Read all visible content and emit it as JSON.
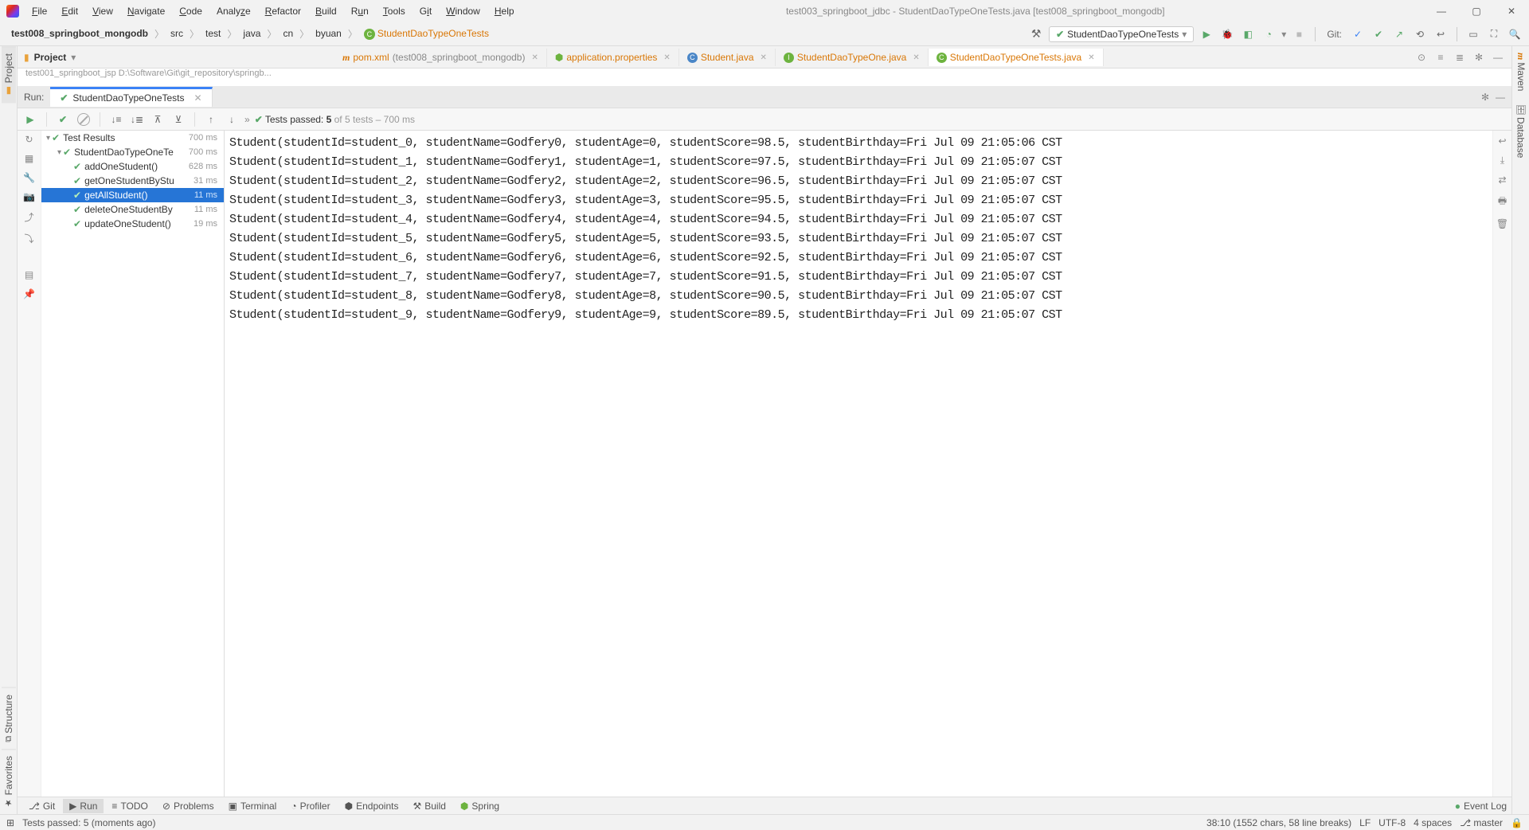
{
  "window": {
    "title": "test003_springboot_jdbc - StudentDaoTypeOneTests.java [test008_springboot_mongodb]"
  },
  "menu": [
    "File",
    "Edit",
    "View",
    "Navigate",
    "Code",
    "Analyze",
    "Refactor",
    "Build",
    "Run",
    "Tools",
    "Git",
    "Window",
    "Help"
  ],
  "breadcrumb": {
    "root": "test008_springboot_mongodb",
    "parts": [
      "src",
      "test",
      "java",
      "cn",
      "byuan"
    ],
    "file": "StudentDaoTypeOneTests"
  },
  "runConfig": "StudentDaoTypeOneTests",
  "gitLabel": "Git:",
  "leftGutter": {
    "project": "Project",
    "structure": "Structure",
    "favorites": "Favorites"
  },
  "rightGutter": {
    "maven": "Maven",
    "database": "Database"
  },
  "projectHeader": "Project",
  "cutLine": "test001_springboot_jsp  D:\\Software\\Git\\git_repository\\springb...",
  "editorTabs": [
    {
      "icon": "m",
      "label": "pom.xml",
      "suffix": "(test008_springboot_mongodb)",
      "color": "orange",
      "active": false
    },
    {
      "icon": "spring",
      "label": "application.properties",
      "color": "orange",
      "active": false
    },
    {
      "icon": "c-blue",
      "label": "Student.java",
      "color": "orange",
      "active": false
    },
    {
      "icon": "c-green",
      "label": "StudentDaoTypeOne.java",
      "color": "orange",
      "active": false
    },
    {
      "icon": "c-green",
      "label": "StudentDaoTypeOneTests.java",
      "color": "orange",
      "active": true
    }
  ],
  "runPanel": {
    "runLabel": "Run:",
    "tabName": "StudentDaoTypeOneTests",
    "summaryPrefix": "Tests passed:",
    "summaryCount": "5",
    "summaryMid": "of 5 tests",
    "summaryTime": "– 700 ms"
  },
  "testTree": {
    "root": {
      "label": "Test Results",
      "time": "700 ms"
    },
    "class": {
      "label": "StudentDaoTypeOneTe",
      "time": "700 ms"
    },
    "tests": [
      {
        "label": "addOneStudent()",
        "time": "628 ms"
      },
      {
        "label": "getOneStudentByStu",
        "time": "31 ms"
      },
      {
        "label": "getAllStudent()",
        "time": "11 ms",
        "selected": true
      },
      {
        "label": "deleteOneStudentBy",
        "time": "11 ms"
      },
      {
        "label": "updateOneStudent()",
        "time": "19 ms"
      }
    ]
  },
  "console": [
    "Student(studentId=student_0, studentName=Godfery0, studentAge=0, studentScore=98.5, studentBirthday=Fri Jul 09 21:05:06 CST",
    "Student(studentId=student_1, studentName=Godfery1, studentAge=1, studentScore=97.5, studentBirthday=Fri Jul 09 21:05:07 CST",
    "Student(studentId=student_2, studentName=Godfery2, studentAge=2, studentScore=96.5, studentBirthday=Fri Jul 09 21:05:07 CST",
    "Student(studentId=student_3, studentName=Godfery3, studentAge=3, studentScore=95.5, studentBirthday=Fri Jul 09 21:05:07 CST",
    "Student(studentId=student_4, studentName=Godfery4, studentAge=4, studentScore=94.5, studentBirthday=Fri Jul 09 21:05:07 CST",
    "Student(studentId=student_5, studentName=Godfery5, studentAge=5, studentScore=93.5, studentBirthday=Fri Jul 09 21:05:07 CST",
    "Student(studentId=student_6, studentName=Godfery6, studentAge=6, studentScore=92.5, studentBirthday=Fri Jul 09 21:05:07 CST",
    "Student(studentId=student_7, studentName=Godfery7, studentAge=7, studentScore=91.5, studentBirthday=Fri Jul 09 21:05:07 CST",
    "Student(studentId=student_8, studentName=Godfery8, studentAge=8, studentScore=90.5, studentBirthday=Fri Jul 09 21:05:07 CST",
    "Student(studentId=student_9, studentName=Godfery9, studentAge=9, studentScore=89.5, studentBirthday=Fri Jul 09 21:05:07 CST"
  ],
  "bottomTabs": {
    "git": "Git",
    "run": "Run",
    "todo": "TODO",
    "problems": "Problems",
    "terminal": "Terminal",
    "profiler": "Profiler",
    "endpoints": "Endpoints",
    "build": "Build",
    "spring": "Spring",
    "eventLog": "Event Log"
  },
  "status": {
    "message": "Tests passed: 5 (moments ago)",
    "pos": "38:10 (1552 chars, 58 line breaks)",
    "lf": "LF",
    "enc": "UTF-8",
    "indent": "4 spaces",
    "branch": "master"
  }
}
